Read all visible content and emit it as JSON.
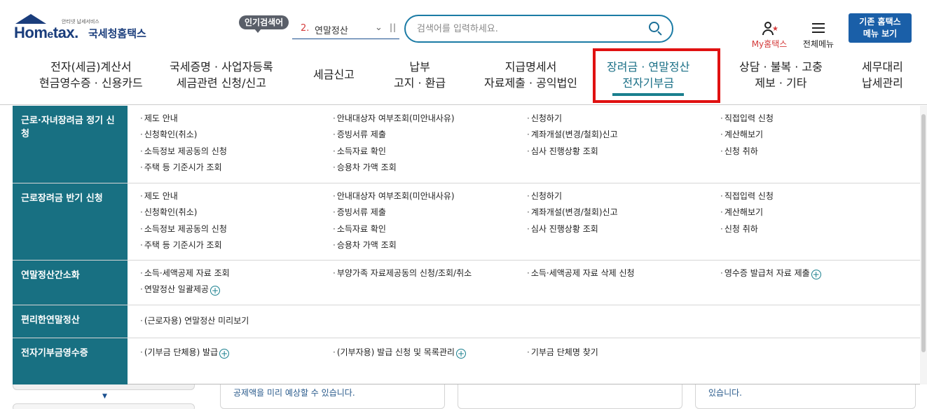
{
  "logo": {
    "tagline": "안티넷 납세서비스",
    "home": "Hom",
    "e": "e",
    "tax": "tax.",
    "kr": "국세청홈택스"
  },
  "popular": {
    "badge": "인기검색어",
    "rank": "2.",
    "keyword": "연말정산"
  },
  "search": {
    "placeholder": "검색어를 입력하세요."
  },
  "utility": {
    "my_home": "My홈택스",
    "all_menu": "전체메뉴",
    "old_hometax_l1": "기존 홈택스",
    "old_hometax_l2": "메뉴 보기"
  },
  "gnb": [
    {
      "l1": "전자(세금)계산서",
      "l2": "현금영수증 · 신용카드"
    },
    {
      "l1": "국세증명 · 사업자등록",
      "l2": "세금관련 신청/신고"
    },
    {
      "l1": "세금신고"
    },
    {
      "l1": "납부",
      "l2": "고지 · 환급"
    },
    {
      "l1": "지급명세서",
      "l2": "자료제출 · 공익법인"
    },
    {
      "l1": "장려금 · 연말정산",
      "l2": "전자기부금"
    },
    {
      "l1": "상담 · 불복 · 고충",
      "l2": "제보 · 기타"
    },
    {
      "l1": "세무대리",
      "l2": "납세관리"
    }
  ],
  "panel": {
    "sections": [
      {
        "title": "근로·자녀장려금 정기 신청",
        "links": [
          "제도 안내",
          "안내대상자 여부조회(미안내사유)",
          "신청하기",
          "직접입력 신청",
          "신청확인(취소)",
          "증빙서류 제출",
          "계좌개설(변경/철회)신고",
          "계산해보기",
          "소득정보 제공동의 신청",
          "소득자료 확인",
          "심사 진행상황 조회",
          "신청 취하",
          "주택 등 기준시가 조회",
          "승용차 가액 조회"
        ]
      },
      {
        "title": "근로장려금 반기 신청",
        "links": [
          "제도 안내",
          "안내대상자 여부조회(미안내사유)",
          "신청하기",
          "직접입력 신청",
          "신청확인(취소)",
          "증빙서류 제출",
          "계좌개설(변경/철회)신고",
          "계산해보기",
          "소득정보 제공동의 신청",
          "소득자료 확인",
          "심사 진행상황 조회",
          "신청 취하",
          "주택 등 기준시가 조회",
          "승용차 가액 조회"
        ]
      },
      {
        "title": "연말정산간소화",
        "links": [
          "소득·세액공제 자료 조회",
          "부양가족 자료제공동의 신청/조회/취소",
          "소득·세액공제 자료 삭제 신청",
          "영수증 발급처 자료 제출",
          "연말정산 일괄제공"
        ]
      },
      {
        "title": "편리한연말정산",
        "links": [
          "(근로자용) 연말정산 미리보기"
        ]
      },
      {
        "title": "전자기부금영수증",
        "links": [
          "(기부금 단체용) 발급",
          "(기부자용) 발급 신청 및 목록관리",
          "기부금 단체명 찾기"
        ]
      }
    ]
  },
  "under": {
    "card1_text": "공제액을 미리 예상할 수 있습니다.",
    "card3_text": "있습니다."
  }
}
